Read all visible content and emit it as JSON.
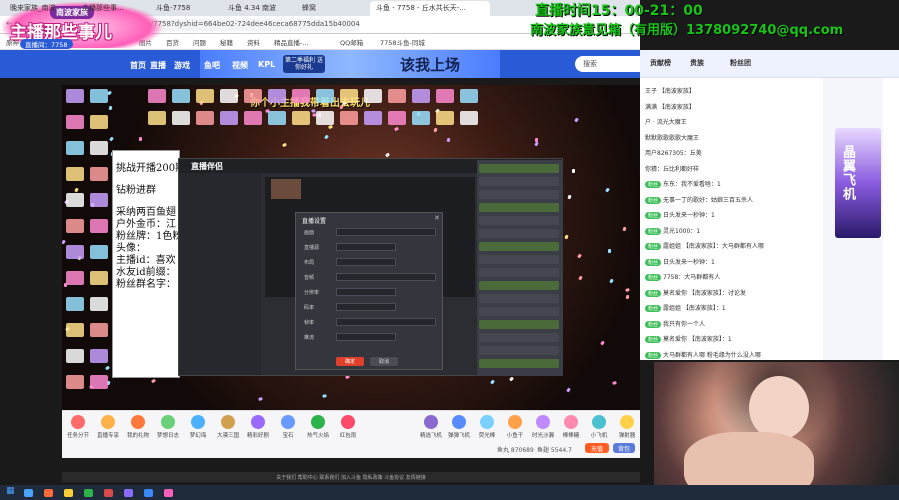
{
  "overlay": {
    "time_label": "直播时间15：00-21：00",
    "subtitle": "南波家族意见箱（有用版）1378092740@qq.com",
    "logo_title": "主播那些事儿",
    "logo_room": "直播间：7758",
    "logo_badge": "南波家族"
  },
  "browser": {
    "tabs": [
      "晚来家族_南波",
      "主播那些事...",
      "斗鱼-7758",
      "斗鱼 4.34 南波",
      "蜂窝",
      "斗鱼 - 7758 - 丘水共长天-..."
    ],
    "address": "https://www.douyu.com/7758?dyshid=664be02-724dee46ceca68775dda15b400041701",
    "bookmarks": [
      "原神",
      "网站-已在点击...",
      "资讯",
      "图片",
      "百货",
      "问题",
      "秘籍",
      "资料",
      "精品直播-...",
      "QQ邮箱",
      "7758斗鱼-同城"
    ]
  },
  "site": {
    "nav": [
      "首页",
      "直播",
      "游戏",
      "鱼吧",
      "视频",
      "KPL"
    ],
    "promo": "第二季福利 送你好礼",
    "slogan": "该我上场",
    "search_placeholder": "搜索",
    "video_overlay": "你个小主播我带着出去玩儿"
  },
  "notepad": {
    "lines": [
      "挑战开播200期",
      "钻粉进群",
      "采纳两百鱼翅",
      "户外金币：江",
      "粉丝牌：1色粉",
      "头像：",
      "主播id：喜欢",
      "水友id前缀：",
      "粉丝群名字："
    ]
  },
  "obs": {
    "title": "直播伴侣",
    "dialog_title": "直播设置",
    "rows": [
      "画面",
      "直播源",
      "布局",
      "音频",
      "分辨率",
      "码率",
      "帧率",
      "推流"
    ],
    "confirm": "确定",
    "cancel": "取消"
  },
  "gifts": [
    {
      "name": "任务分节",
      "color": "#ff6a6a"
    },
    {
      "name": "直播专享",
      "color": "#ffb24a"
    },
    {
      "name": "我的礼物",
      "color": "#ff7a3a"
    },
    {
      "name": "梦想日志",
      "color": "#6ad07a"
    },
    {
      "name": "梦幻海",
      "color": "#4ab0ff"
    },
    {
      "name": "大漠三国",
      "color": "#d0a050"
    },
    {
      "name": "精彩好剧",
      "color": "#9a6aff"
    },
    {
      "name": "宝石",
      "color": "#6a9aff"
    },
    {
      "name": "热气火焰",
      "color": "#2cb34a"
    },
    {
      "name": "红包雨",
      "color": "#ff4a6a"
    },
    {
      "name": "精选飞机",
      "color": "#8a6ad0"
    },
    {
      "name": "弹弹飞机",
      "color": "#5a8aff"
    },
    {
      "name": "荧光棒",
      "color": "#7ad0ff"
    },
    {
      "name": "小鱼干",
      "color": "#ffa04a"
    },
    {
      "name": "时光沙漏",
      "color": "#c08aff"
    },
    {
      "name": "棒棒糖",
      "color": "#ff8ab0"
    },
    {
      "name": "小飞机",
      "color": "#4ac0d0"
    },
    {
      "name": "弹射器",
      "color": "#ffd04a"
    }
  ],
  "stream_info": {
    "fans": "鱼丸 870689",
    "fish": "鱼翅 5544.7",
    "recharge_btn": "充值",
    "gift_btn": "背包",
    "footer": "关于我们  帮助中心  联系我们  加入斗鱼  隐私政策  斗鱼协议  友情链接"
  },
  "right": {
    "tabs": [
      "贡献榜",
      "贵族",
      "粉丝团"
    ],
    "chat": [
      {
        "badge": "",
        "badge_color": "#aaa",
        "text": "王子 【南波家族】"
      },
      {
        "badge": "",
        "badge_color": "#aaa",
        "text": "满满 【南波家族】"
      },
      {
        "badge": "",
        "badge_color": "#aaa",
        "text": "户 · 流光大魔王"
      },
      {
        "badge": "",
        "badge_color": "#aaa",
        "text": "默默歌歌歌歌大魔王"
      },
      {
        "badge": "",
        "badge_color": "#aaa",
        "text": "用户8267305：丘美"
      },
      {
        "badge": "",
        "badge_color": "#aaa",
        "text": "你猜：丘比利都好样"
      },
      {
        "badge": "粉丝",
        "badge_color": "#3fbf5a",
        "text": "东东：我不爱看啥：1"
      },
      {
        "badge": "粉丝",
        "badge_color": "#3fbf5a",
        "text": "无事一丁的歌好：姑娘三百五杀人"
      },
      {
        "badge": "粉丝",
        "badge_color": "#3fbf5a",
        "text": "日头发来一秒钟：1"
      },
      {
        "badge": "粉丝",
        "badge_color": "#3fbf5a",
        "text": "灵光1000：1"
      },
      {
        "badge": "粉丝",
        "badge_color": "#3fbf5a",
        "text": "露姐姐 【南波家族】：大马群都有人哪"
      },
      {
        "badge": "粉丝",
        "badge_color": "#3fbf5a",
        "text": "日头发来一秒钟：1"
      },
      {
        "badge": "粉丝",
        "badge_color": "#3fbf5a",
        "text": "7758：大马群都有人"
      },
      {
        "badge": "粉丝",
        "badge_color": "#3fbf5a",
        "text": "莫名爱你 【南波家族】：讨论发"
      },
      {
        "badge": "粉丝",
        "badge_color": "#3fbf5a",
        "text": "露姐姐 【南波家族】：1"
      },
      {
        "badge": "粉丝",
        "badge_color": "#3fbf5a",
        "text": "我只有你一个人"
      },
      {
        "badge": "粉丝",
        "badge_color": "#3fbf5a",
        "text": "莫名爱你 【南波家族】：1"
      },
      {
        "badge": "粉丝",
        "badge_color": "#3fbf5a",
        "text": "大马群都有人哪 粉毛缘为什么没人哪"
      }
    ],
    "promo_text": "晶翼飞机"
  }
}
